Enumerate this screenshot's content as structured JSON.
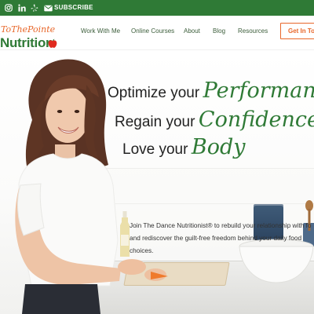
{
  "topbar": {
    "icons": [
      "instagram-icon",
      "linkedin-icon",
      "yelp-icon",
      "mail-icon"
    ],
    "subscribe_label": "SUBSCRIBE",
    "background_color": "#2f7a36"
  },
  "header": {
    "logo_top": "ToThePointe",
    "logo_main": "Nutrition",
    "nav": [
      "Work With Me",
      "Online Courses",
      "About",
      "Blog",
      "Resources"
    ],
    "cta_label": "Get In To",
    "brand_green": "#2f7a36",
    "brand_orange": "#e8672a"
  },
  "hero": {
    "line1_plain": "Optimize your",
    "line1_script": "Performance",
    "line2_plain": "Regain your",
    "line2_script": "Confidence",
    "line3_plain": "Love your",
    "line3_script": "Body",
    "paragraph_line1": "Join The Dance Nutritionist® to rebuild your relationship with fo",
    "paragraph_line2": "and rediscover the guilt-free freedom behind your daily food",
    "paragraph_line3": "choices."
  }
}
